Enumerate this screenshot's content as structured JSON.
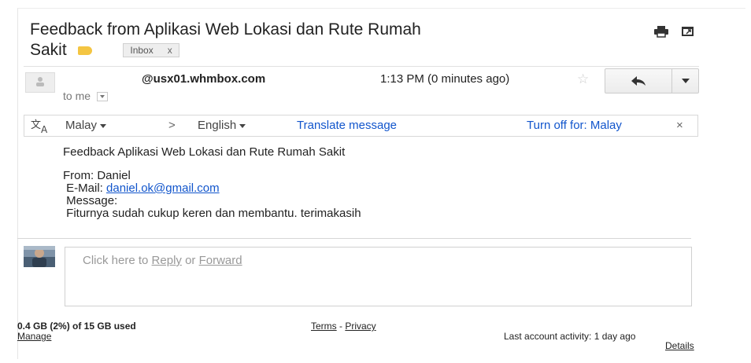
{
  "email": {
    "subject_line1": "Feedback from Aplikasi Web Lokasi dan Rute Rumah",
    "subject_line2": "Sakit",
    "label_chip": "Inbox",
    "label_chip_close": "x",
    "label_color": "#f4c542"
  },
  "header": {
    "sender": "@usx01.whmbox.com",
    "time": "1:13 PM (0 minutes ago)",
    "to": "to me",
    "icons": [
      "print-icon",
      "new-window-icon",
      "star-icon",
      "reply-icon",
      "more-dropdown-icon"
    ]
  },
  "translate_bar": {
    "from_lang": "Malay",
    "arrow": ">",
    "to_lang": "English",
    "translate_link": "Translate message",
    "turn_off": "Turn off for: Malay",
    "close": "×"
  },
  "message": {
    "title": "Feedback Aplikasi Web Lokasi dan Rute Rumah Sakit",
    "from_line": "From: Daniel",
    "email_label": " E-Mail: ",
    "email_value": "daniel.ok@gmail.com",
    "message_label": " Message:",
    "message_body": " Fiturnya sudah cukup keren dan membantu. terimakasih"
  },
  "reply": {
    "prefix": "Click here to ",
    "reply_link": "Reply",
    "middle": " or ",
    "forward_link": "Forward"
  },
  "footer": {
    "quota": "0.4 GB (2%) of 15 GB used",
    "manage": "Manage",
    "terms": "Terms",
    "separator": " - ",
    "privacy": "Privacy",
    "activity": "Last account activity: 1 day ago",
    "details": "Details"
  },
  "colors": {
    "link": "#1155cc",
    "label_tag": "#f4c542"
  }
}
